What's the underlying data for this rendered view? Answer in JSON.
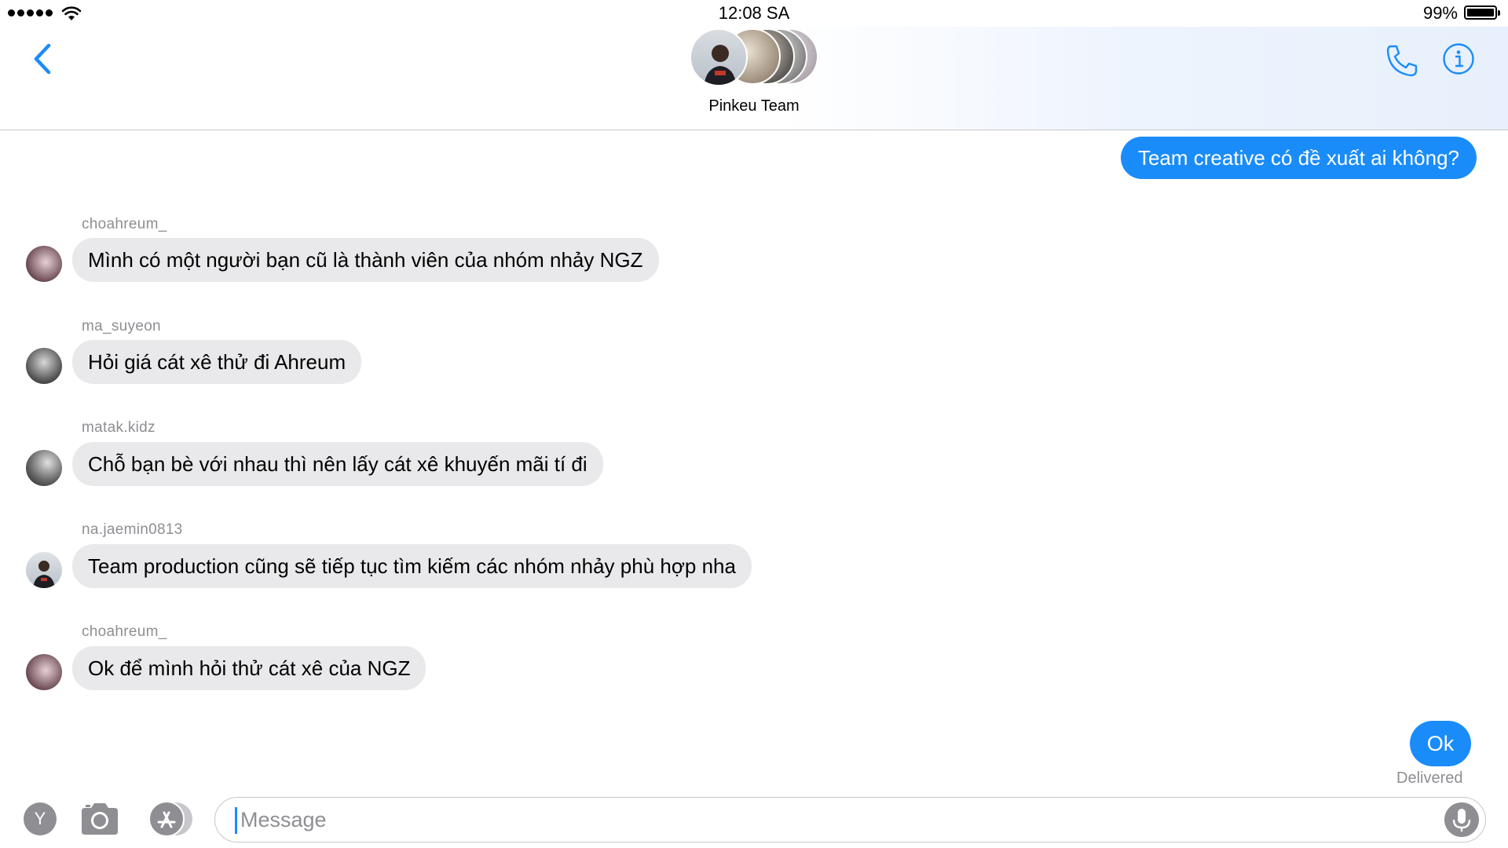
{
  "status_bar": {
    "time": "12:08 SA",
    "battery_percent": "99%",
    "signal_bars": 5,
    "battery_level": 0.99
  },
  "header": {
    "title": "Pinkeu Team",
    "back_icon": "chevron-left-icon",
    "call_icon": "phone-icon",
    "info_icon": "info-icon",
    "accent_color": "#1a8cfa"
  },
  "messages": [
    {
      "direction": "outgoing",
      "text": "Team creative có đề xuất ai không?"
    },
    {
      "direction": "incoming",
      "sender": "choahreum_",
      "text": "Mình có một người bạn cũ là thành viên của nhóm nhảy NGZ"
    },
    {
      "direction": "incoming",
      "sender": "ma_suyeon",
      "text": "Hỏi giá cát xê thử đi Ahreum"
    },
    {
      "direction": "incoming",
      "sender": "matak.kidz",
      "text": "Chỗ bạn bè với nhau thì nên lấy cát xê khuyến mãi tí đi"
    },
    {
      "direction": "incoming",
      "sender": "na.jaemin0813",
      "text": "Team production cũng sẽ tiếp tục tìm kiếm các nhóm nhảy phù hợp nha"
    },
    {
      "direction": "incoming",
      "sender": "choahreum_",
      "text": "Ok để mình hỏi thử cát xê của NGZ"
    },
    {
      "direction": "outgoing",
      "text": "Ok",
      "status": "Delivered"
    }
  ],
  "composer": {
    "app_button_label": "Y",
    "placeholder": "Message",
    "camera_icon": "camera-icon",
    "apps_icon": "app-store-icon",
    "mic_icon": "microphone-icon"
  },
  "colors": {
    "outgoing_bubble": "#1a8cfa",
    "incoming_bubble": "#e9e9eb",
    "secondary_text": "#8e8e93"
  }
}
